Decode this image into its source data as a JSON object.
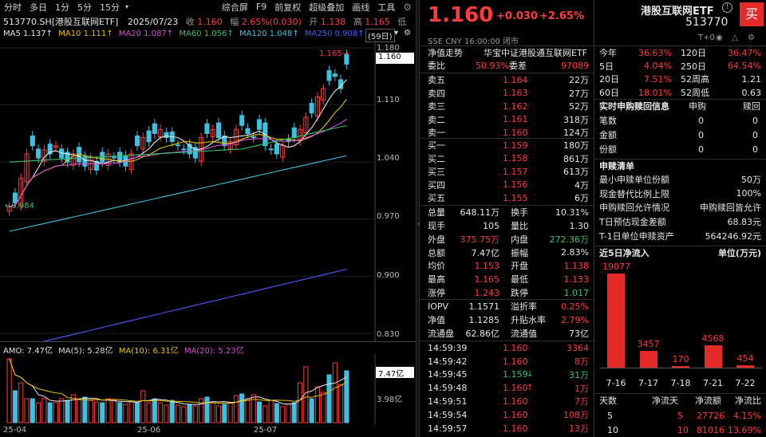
{
  "toolbar": {
    "items": [
      "分时",
      "多日",
      "1分",
      "5分",
      "15分",
      "综合屏",
      "F9",
      "前复权",
      "超级叠加",
      "画线",
      "工具"
    ],
    "gear": "⚙",
    "chevron": "‹"
  },
  "info": {
    "code": "513770.SH[港股互联网ETF]",
    "date": "2025/07/23",
    "shou_l": "收",
    "shou": "1.160",
    "fu_l": "幅",
    "fu": "2.65%(0.030)",
    "kai_l": "开",
    "kai": "1.138",
    "gao_l": "高",
    "gao": "1.165",
    "di_l": "低"
  },
  "ma": {
    "ma5": "MA5 1.137↑",
    "ma10": "MA10 1.111↑",
    "ma20": "MA20 1.087↑",
    "ma60": "MA60 1.056↑",
    "ma120": "MA120 1.048↑",
    "ma250": "MA250 0.908↑",
    "period": "(59日)",
    "colors": {
      "ma5": "#e8e8e8",
      "ma10": "#e8c200",
      "ma20": "#d94fd9",
      "ma60": "#33c36b",
      "ma120": "#3ec1e0",
      "ma250": "#4a5cff"
    }
  },
  "yaxis": [
    "1.180",
    "1.110",
    "1.040",
    "0.970",
    "0.900",
    "0.830"
  ],
  "price_tag": "1.160",
  "hi_label": "1.165",
  "lo_label": "0.984",
  "vol": {
    "amo": "AMO: 7.47亿",
    "ma5": "MA(5): 5.28亿",
    "ma10": "MA(10): 6.31亿",
    "ma20": "MA(20): 5.23亿",
    "tag": "7.47亿",
    "mid": "3.98亿"
  },
  "xaxis": [
    "25-04",
    "25-06",
    "25-07"
  ],
  "header": {
    "price": "1.160",
    "chg": "+0.030",
    "pct": "+2.65%",
    "name": "港股互联网ETF",
    "code": "513770",
    "sub": "SSE CNY 16:00:00 闭市",
    "buy_btn": "买",
    "t0": "T+0"
  },
  "nav": {
    "l": "净值走势",
    "r": "华宝中证港股通互联网ETF"
  },
  "weibi": {
    "l1": "委比",
    "v1": "50.93%",
    "l2": "委差",
    "v2": "97089"
  },
  "asks": [
    [
      "卖五",
      "1.164",
      "22万"
    ],
    [
      "卖四",
      "1.163",
      "27万"
    ],
    [
      "卖三",
      "1.162",
      "52万"
    ],
    [
      "卖二",
      "1.161",
      "318万"
    ],
    [
      "卖一",
      "1.160",
      "124万"
    ]
  ],
  "bids": [
    [
      "买一",
      "1.159",
      "180万"
    ],
    [
      "买二",
      "1.158",
      "861万"
    ],
    [
      "买三",
      "1.157",
      "613万"
    ],
    [
      "买四",
      "1.156",
      "4万"
    ],
    [
      "买五",
      "1.155",
      "6万"
    ]
  ],
  "stats": [
    [
      "总量",
      "648.11万",
      "换手",
      "10.31%"
    ],
    [
      "现手",
      "105",
      "量比",
      "1.30"
    ],
    [
      "外盘",
      "375.75万",
      "内盘",
      "272.36万"
    ],
    [
      "总额",
      "7.47亿",
      "振幅",
      "2.83%"
    ],
    [
      "均价",
      "1.153",
      "开盘",
      "1.138"
    ],
    [
      "最高",
      "1.165",
      "最低",
      "1.133"
    ],
    [
      "涨停",
      "1.243",
      "跌停",
      "1.017"
    ]
  ],
  "iopv": [
    [
      "IOPV",
      "1.1571",
      "溢折率",
      "0.25%"
    ],
    [
      "净值",
      "1.1285",
      "升贴水率",
      "2.79%"
    ],
    [
      "流通盘",
      "62.86亿",
      "流通值",
      "73亿"
    ]
  ],
  "ticks": [
    [
      "14:59:39",
      "1.160",
      "3364",
      ""
    ],
    [
      "14:59:42",
      "1.160",
      "8万",
      ""
    ],
    [
      "14:59:45",
      "1.159",
      "31万",
      "down"
    ],
    [
      "14:59:48",
      "1.160",
      "1万",
      "up"
    ],
    [
      "14:59:51",
      "1.160",
      "7万",
      ""
    ],
    [
      "14:59:54",
      "1.160",
      "108万",
      ""
    ],
    [
      "14:59:57",
      "1.160",
      "13万",
      ""
    ]
  ],
  "perf": [
    [
      "今年",
      "36.63%",
      "120日",
      "36.47%"
    ],
    [
      "5日",
      "4.04%",
      "250日",
      "64.54%"
    ],
    [
      "20日",
      "7.51%",
      "52周高",
      "1.21"
    ],
    [
      "60日",
      "18.01%",
      "52周低",
      "0.63"
    ]
  ],
  "realtime": {
    "title": "实时申购赎回信息",
    "c1": "申购",
    "c2": "赎回",
    "rows": [
      [
        "笔数",
        "0",
        "0"
      ],
      [
        "金额",
        "0",
        "0"
      ],
      [
        "份额",
        "0",
        "0"
      ]
    ]
  },
  "list": {
    "title": "申赎清单",
    "rows": [
      [
        "最小申赎单位份额",
        "50万"
      ],
      [
        "现金替代比例上限",
        "100%"
      ],
      [
        "申购赎回允许情况",
        "申购赎回皆允许"
      ],
      [
        "T日预估现金差额",
        "68.83元"
      ],
      [
        "T-1日单位申赎资产",
        "564246.92元"
      ]
    ]
  },
  "flow": {
    "title": "近5日净流入",
    "unit": "单位(万元)",
    "bars": [
      {
        "d": "7-16",
        "v": 19077
      },
      {
        "d": "7-17",
        "v": 3457
      },
      {
        "d": "7-18",
        "v": 170
      },
      {
        "d": "7-21",
        "v": 4568
      },
      {
        "d": "7-22",
        "v": 454
      }
    ]
  },
  "flowtbl": {
    "head": [
      "天数",
      "净流天",
      "净流额",
      "净流比"
    ],
    "rows": [
      [
        "5",
        "5",
        "27726",
        "4.15%"
      ],
      [
        "10",
        "10",
        "81016",
        "13.69%"
      ]
    ]
  }
}
